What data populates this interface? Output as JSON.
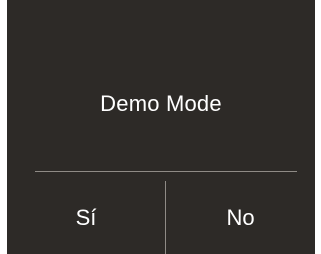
{
  "dialog": {
    "title": "Demo Mode",
    "yes_label": "Sí",
    "no_label": "No"
  },
  "colors": {
    "background": "#2d2a27",
    "text": "#ffffff",
    "divider": "#8f8b86"
  }
}
